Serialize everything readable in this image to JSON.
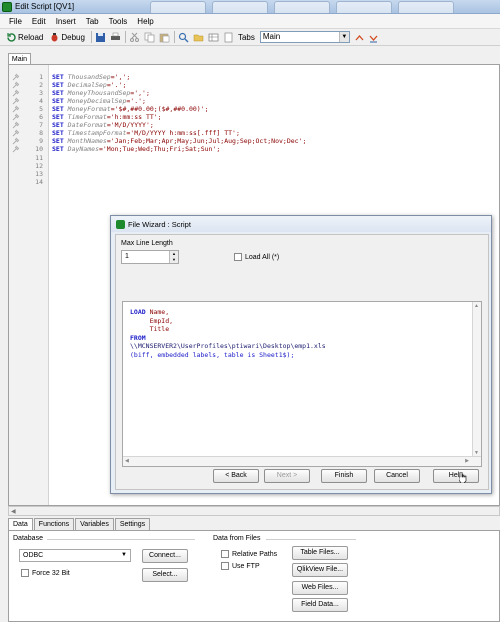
{
  "window": {
    "title": "Edit Script [QV1]"
  },
  "menu": [
    "File",
    "Edit",
    "Insert",
    "Tab",
    "Tools",
    "Help"
  ],
  "toolbar": {
    "reload": "Reload",
    "debug": "Debug",
    "tabs_label": "Tabs",
    "tabs_value": "Main"
  },
  "script_tab": "Main",
  "code_lines": [
    {
      "n": "1",
      "kw": "SET",
      "var": "ThousandSep",
      "val": "=',';"
    },
    {
      "n": "2",
      "kw": "SET",
      "var": "DecimalSep",
      "val": "='.';"
    },
    {
      "n": "3",
      "kw": "SET",
      "var": "MoneyThousandSep",
      "val": "=',';"
    },
    {
      "n": "4",
      "kw": "SET",
      "var": "MoneyDecimalSep",
      "val": "='.';"
    },
    {
      "n": "5",
      "kw": "SET",
      "var": "MoneyFormat",
      "val": "='$#,##0.00;($#,##0.00)';"
    },
    {
      "n": "6",
      "kw": "SET",
      "var": "TimeFormat",
      "val": "='h:mm:ss TT';"
    },
    {
      "n": "7",
      "kw": "SET",
      "var": "DateFormat",
      "val": "='M/D/YYYY';"
    },
    {
      "n": "8",
      "kw": "SET",
      "var": "TimestampFormat",
      "val": "='M/D/YYYY h:mm:ss[.fff] TT';"
    },
    {
      "n": "9",
      "kw": "SET",
      "var": "MonthNames",
      "val": "='Jan;Feb;Mar;Apr;May;Jun;Jul;Aug;Sep;Oct;Nov;Dec';"
    },
    {
      "n": "10",
      "kw": "SET",
      "var": "DayNames",
      "val": "='Mon;Tue;Wed;Thu;Fri;Sat;Sun';"
    },
    {
      "n": "11",
      "kw": "",
      "var": "",
      "val": ""
    },
    {
      "n": "12",
      "kw": "",
      "var": "",
      "val": ""
    },
    {
      "n": "13",
      "kw": "",
      "var": "",
      "val": ""
    },
    {
      "n": "14",
      "kw": "",
      "var": "",
      "val": ""
    }
  ],
  "bottom_tabs": [
    "Data",
    "Functions",
    "Variables",
    "Settings"
  ],
  "panel": {
    "database_label": "Database",
    "db_value": "ODBC",
    "connect": "Connect...",
    "select": "Select...",
    "force32": "Force 32 Bit",
    "files_label": "Data from Files",
    "relative_paths": "Relative Paths",
    "use_ftp": "Use FTP",
    "table_files": "Table Files...",
    "qlikview_file": "QlikView File...",
    "web_files": "Web Files...",
    "field_data": "Field Data..."
  },
  "dialog": {
    "title": "File Wizard : Script",
    "max_line_label": "Max Line Length",
    "max_line_value": "1",
    "load_all": "Load All (*)",
    "script_lines": [
      {
        "kw": "LOAD",
        "rest": " Name,",
        "rest_class": "str"
      },
      {
        "kw": "",
        "rest": "     EmpId,",
        "rest_class": "str"
      },
      {
        "kw": "",
        "rest": "     Title",
        "rest_class": "str"
      },
      {
        "kw": "FROM",
        "rest": "",
        "rest_class": ""
      },
      {
        "kw": "",
        "rest": "\\\\MCNSERVER2\\UserProfiles\\ptiwari\\Desktop\\emp1.xls",
        "rest_class": ""
      },
      {
        "kw": "",
        "rest": "(biff, embedded labels, table is Sheet1$);",
        "rest_class": "kw-blue"
      }
    ],
    "buttons": {
      "back": "< Back",
      "next": "Next >",
      "finish": "Finish",
      "cancel": "Cancel",
      "help": "Help"
    }
  },
  "colors": {
    "keyword": "#1a1ac8",
    "variable": "#808080",
    "string": "#8b0000",
    "accent": "#1f8a2d"
  }
}
